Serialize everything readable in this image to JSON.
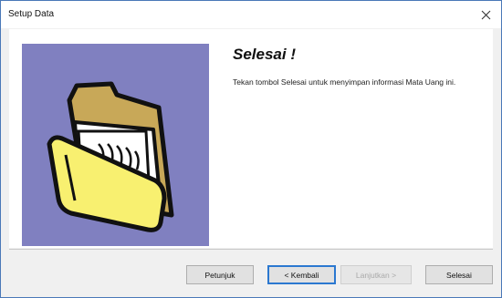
{
  "window": {
    "title": "Setup Data",
    "close_icon": "close-icon"
  },
  "content": {
    "heading": "Selesai !",
    "description": "Tekan tombol Selesai untuk menyimpan informasi Mata Uang ini.",
    "illustration_icon": "open-folder-icon"
  },
  "buttons": {
    "help": "Petunjuk",
    "back": "< Kembali",
    "next": "Lanjutkan >",
    "finish": "Selesai"
  },
  "colors": {
    "illustration_background": "#8080c0",
    "folder_back": "#c8a858",
    "folder_front": "#f8f070",
    "default_button_border": "#2b78d0",
    "window_border": "#4a78b8"
  }
}
